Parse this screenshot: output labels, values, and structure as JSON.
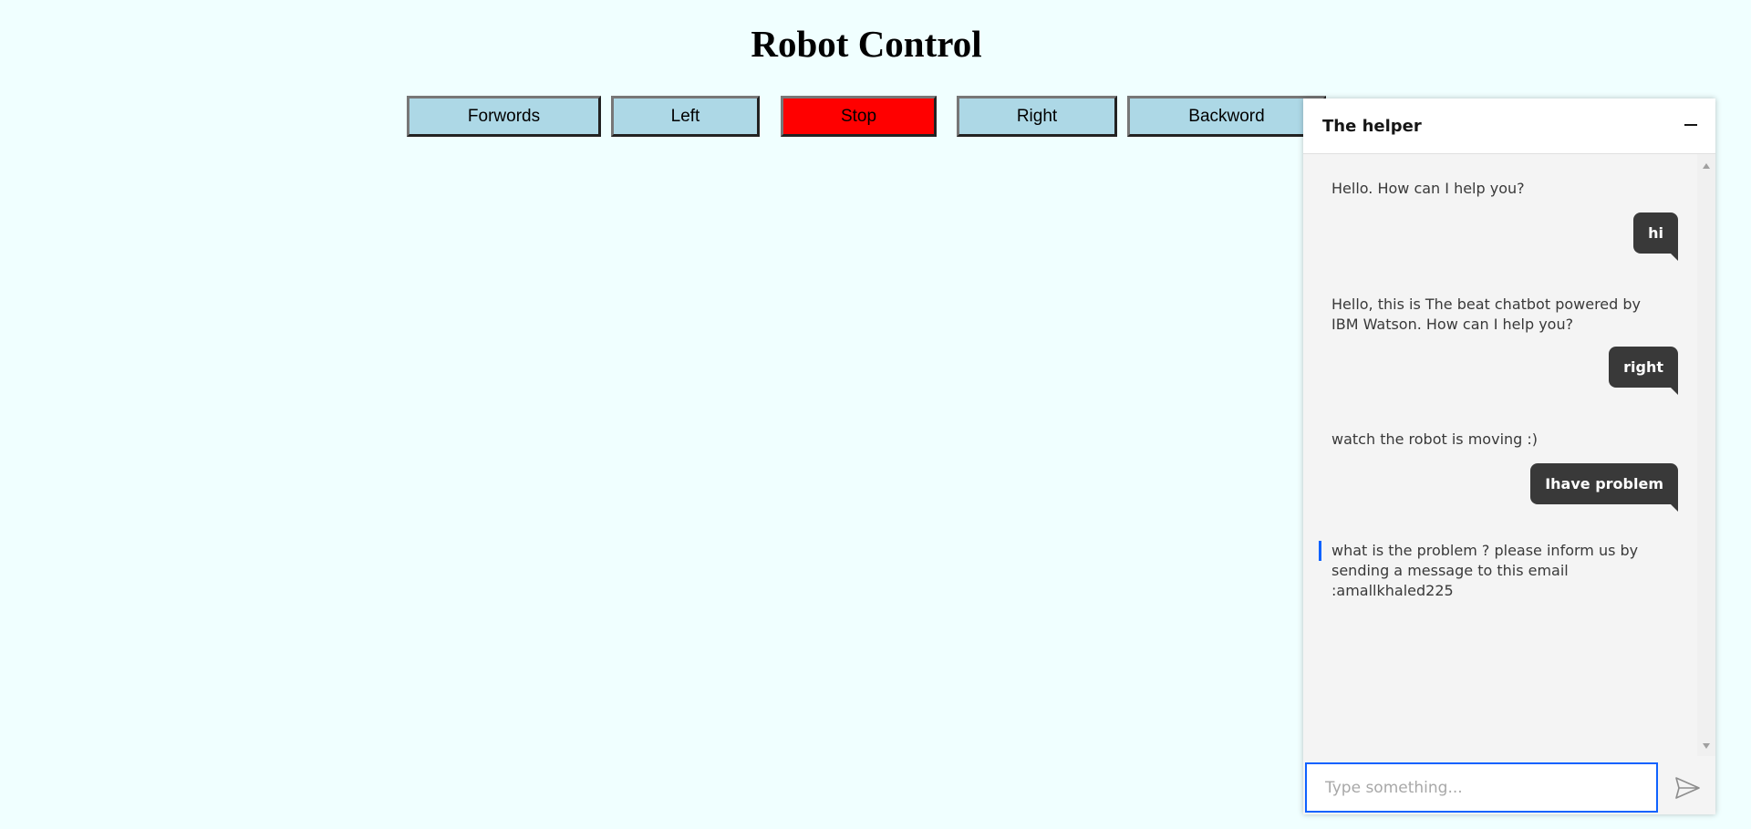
{
  "page": {
    "title": "Robot Control"
  },
  "controls": {
    "forward": "Forwords",
    "left": "Left",
    "stop": "Stop",
    "right": "Right",
    "backward": "Backword"
  },
  "colors": {
    "background": "#f0ffff",
    "button": "#add8e6",
    "stop_button": "#ff0000",
    "chat_accent": "#0f62fe",
    "user_bubble": "#393939"
  },
  "chat": {
    "title": "The helper",
    "minimize_icon": "minus-icon",
    "send_icon": "send-icon",
    "input_placeholder": "Type something...",
    "messages": [
      {
        "from": "bot",
        "text": "Hello. How can I help you?"
      },
      {
        "from": "user",
        "text": "hi"
      },
      {
        "from": "bot",
        "text": "Hello, this is The beat chatbot powered by IBM Watson. How can I help you?"
      },
      {
        "from": "user",
        "text": "right"
      },
      {
        "from": "bot",
        "text": "watch the robot is moving :)"
      },
      {
        "from": "user",
        "text": "Ihave problem"
      },
      {
        "from": "bot",
        "text": "what is the problem ? please inform us by sending a message to this email :amallkhaled225"
      }
    ]
  }
}
